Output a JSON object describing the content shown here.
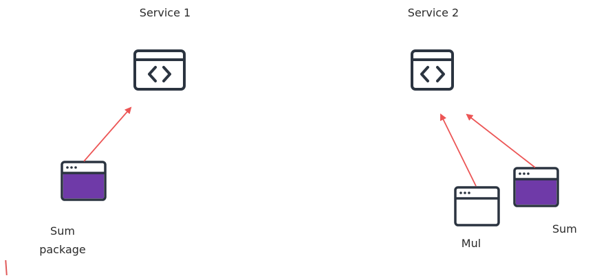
{
  "service1": {
    "title": "Service 1",
    "icon": "code-window-icon"
  },
  "service2": {
    "title": "Service 2",
    "icon": "code-window-icon"
  },
  "packages": {
    "sum_package": {
      "label_line1": "Sum",
      "label_line2": "package",
      "icon": "browser-window-icon",
      "fill": "#6f3aa8"
    },
    "mul": {
      "label": "Mul",
      "icon": "browser-window-icon",
      "fill": "#ffffff"
    },
    "sum": {
      "label": "Sum",
      "icon": "browser-window-icon",
      "fill": "#6f3aa8"
    }
  },
  "colors": {
    "stroke": "#2b3440",
    "arrow": "#ec5555",
    "purple": "#6f3aa8"
  }
}
